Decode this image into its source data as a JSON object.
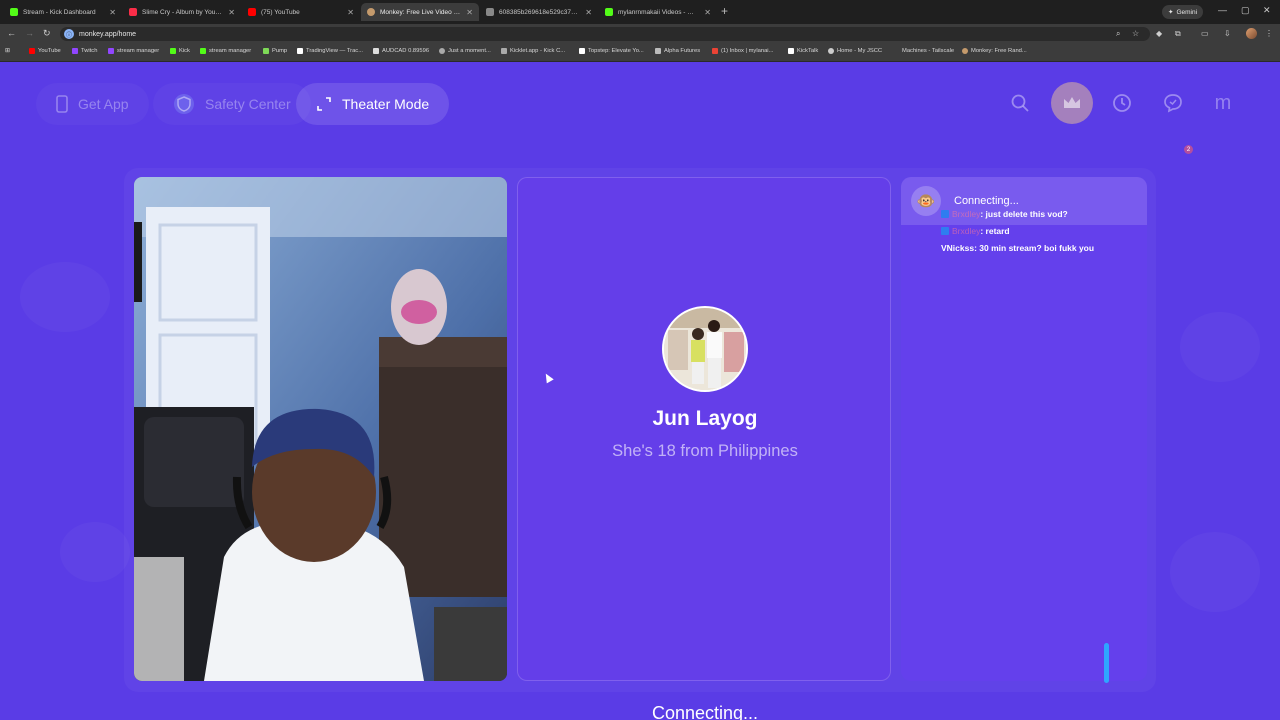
{
  "browser": {
    "tabs": [
      {
        "title": "Stream - Kick Dashboard",
        "color": "#53fc18"
      },
      {
        "title": "Slime Cry - Album by YoungBoy",
        "color": "#fa2d48"
      },
      {
        "title": "(75) YouTube",
        "color": "#ff0000"
      },
      {
        "title": "Monkey: Free Live Video Ch",
        "color": "#c49a6c"
      },
      {
        "title": "608385b269618e529c379c92",
        "color": "#888888"
      },
      {
        "title": "mylanrnmakaii Videos - Watch C",
        "color": "#53fc18"
      }
    ],
    "new_tab": "+",
    "gemini_label": "Gemini",
    "url": "monkey.app/home",
    "bookmarks": [
      "YouTube",
      "Twitch",
      "stream manager",
      "Kick",
      "stream manager",
      "Pump",
      "TradingView — Trac...",
      "AUDCAD 0.89596",
      "Just a moment...",
      "Kicklet.app - Kick C...",
      "Topstep: Elevate Yo...",
      "Alpha Futures",
      "(1) Inbox | mylanai...",
      "KickTalk",
      "Home - My JSCC",
      "Machines - Tailscale",
      "Monkey: Free Rand..."
    ]
  },
  "nav": {
    "get_app": "Get App",
    "safety_center": "Safety Center",
    "theater_mode": "Theater Mode",
    "profile_letter": "m",
    "notification_count": "2"
  },
  "partner": {
    "name": "Jun Layog",
    "description": "She's 18 from Philippines",
    "status": "Connecting..."
  },
  "chat": {
    "status": "Connecting...",
    "messages": [
      {
        "user": "Brxdley",
        "text": ": just delete this vod?"
      },
      {
        "user": "Brxdley",
        "text": ": retard"
      },
      {
        "user": "VNickss",
        "text": " : 30 min stream? boi fukk you"
      }
    ]
  }
}
